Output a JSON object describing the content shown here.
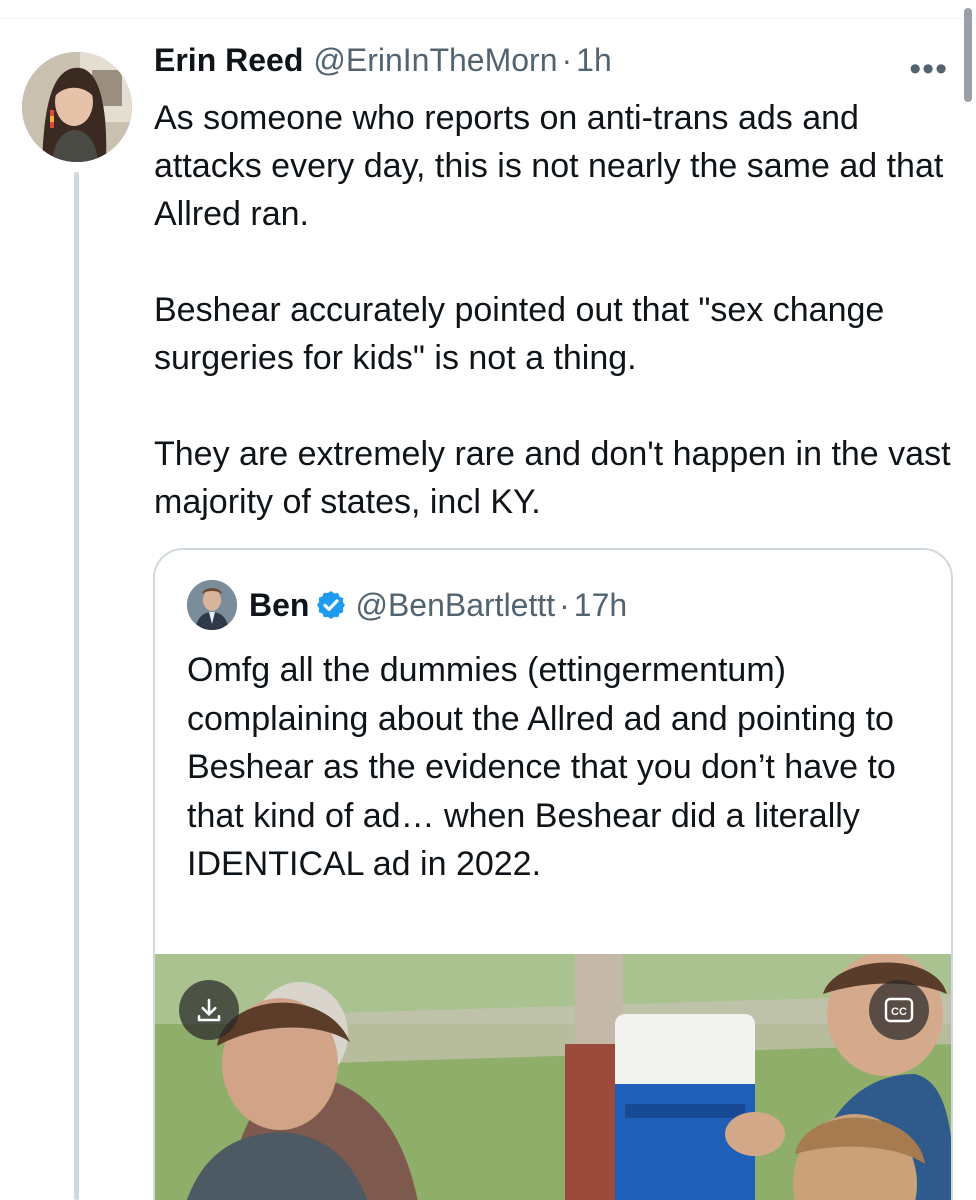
{
  "tweet": {
    "author_name": "Erin Reed",
    "author_handle": "@ErinInTheMorn",
    "separator": "·",
    "time": "1h",
    "more_label": "•••",
    "paragraphs": [
      "As someone who reports on anti-trans ads and attacks every day, this is not nearly the same ad that Allred ran.",
      "Beshear accurately pointed out that \"sex change surgeries for kids\" is not a thing.",
      "They are extremely rare and don't happen in the vast majority of states, incl KY."
    ]
  },
  "quoted_tweet": {
    "author_name": "Ben",
    "author_handle": "@BenBartlettt",
    "separator": "·",
    "time": "17h",
    "verified_icon": "verified-badge-icon",
    "text": "Omfg all the dummies (ettingermentum) complaining about the Allred ad and pointing to Beshear as the evidence that you don’t have to that kind of ad… when Beshear did a literally IDENTICAL ad in 2022.",
    "media": {
      "download_icon": "download-icon",
      "captions_icon": "closed-captions-icon",
      "captions_label": "CC"
    }
  },
  "colors": {
    "text_primary": "#0f1419",
    "text_secondary": "#536471",
    "border": "#cfd9de",
    "verified_blue": "#1d9bf0"
  }
}
